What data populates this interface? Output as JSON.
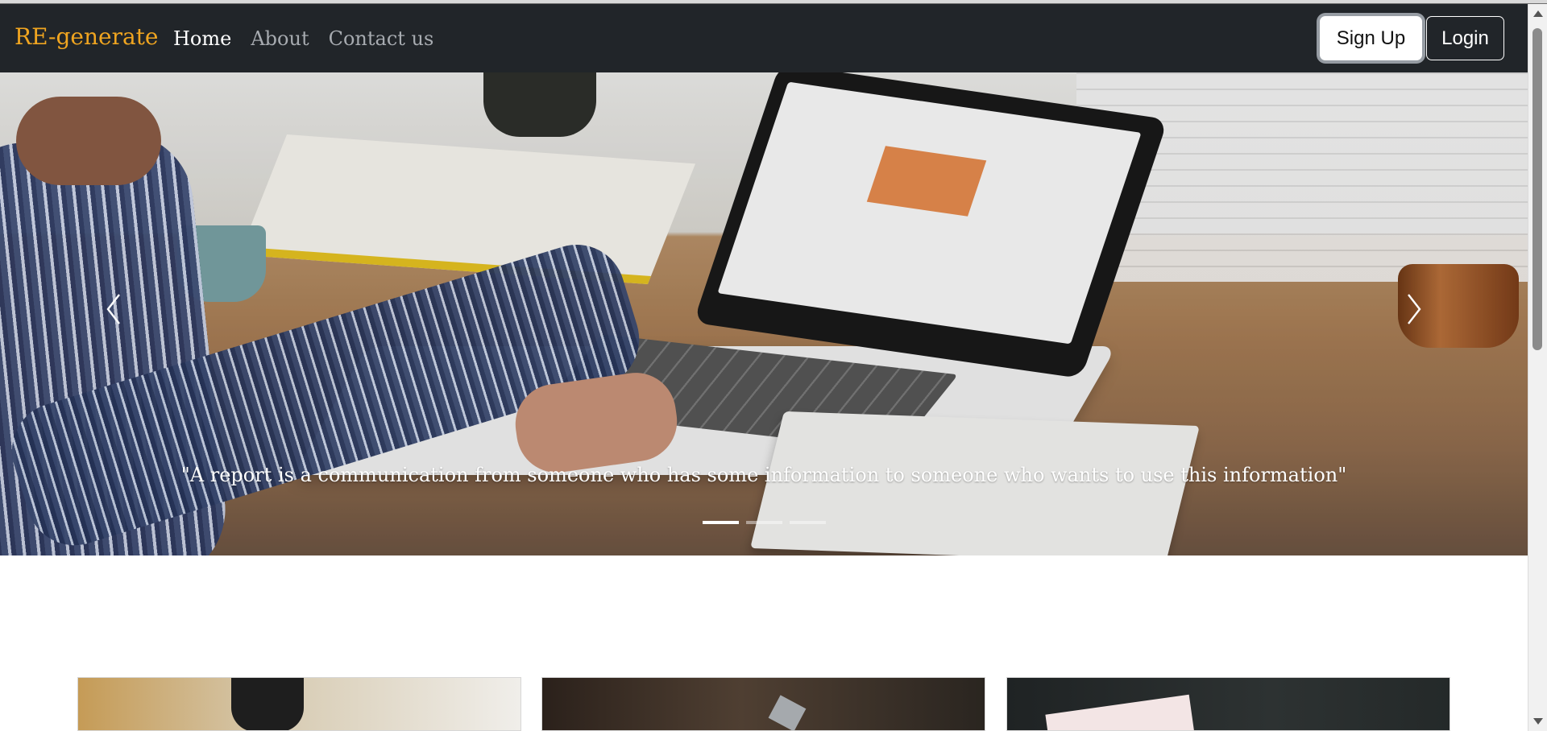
{
  "navbar": {
    "brand": "RE-generate",
    "links": [
      {
        "label": "Home"
      },
      {
        "label": "About"
      },
      {
        "label": "Contact us"
      }
    ],
    "buttons": {
      "signup": "Sign Up",
      "login": "Login"
    }
  },
  "hero": {
    "caption": "\"A report is a communication from someone who has some information to someone who wants to use this information\""
  },
  "colors": {
    "navbar_bg": "#212529",
    "brand": "#f0a520",
    "active_link": "#ffffff",
    "inactive_link": "#a7abb0"
  },
  "icons": {
    "carousel_prev": "chevron-left-icon",
    "carousel_next": "chevron-right-icon",
    "scroll_up": "arrow-up-icon",
    "scroll_down": "arrow-down-icon"
  }
}
